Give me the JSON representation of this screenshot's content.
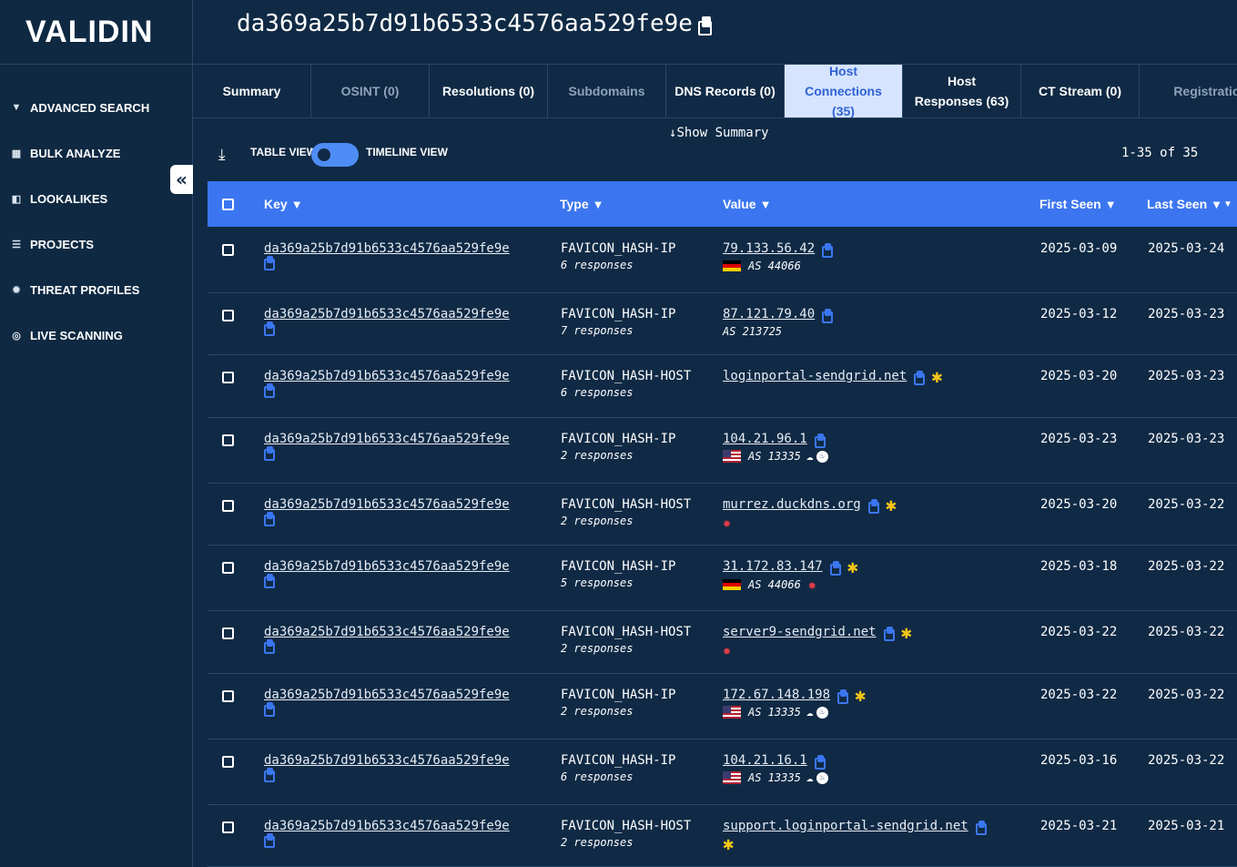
{
  "app": {
    "logo": "VALIDIN"
  },
  "sidebar": {
    "items": [
      {
        "label": "ADVANCED SEARCH",
        "icon": "filter-icon"
      },
      {
        "label": "BULK ANALYZE",
        "icon": "grid-icon"
      },
      {
        "label": "LOOKALIKES",
        "icon": "lookalike-icon"
      },
      {
        "label": "PROJECTS",
        "icon": "list-icon"
      },
      {
        "label": "THREAT PROFILES",
        "icon": "bug-icon"
      },
      {
        "label": "LIVE SCANNING",
        "icon": "target-icon"
      }
    ],
    "collapse_glyph": "«"
  },
  "header": {
    "title": "da369a25b7d91b6533c4576aa529fe9e"
  },
  "tabs": [
    {
      "label": "Summary"
    },
    {
      "label": "OSINT (0)"
    },
    {
      "label": "Resolutions (0)"
    },
    {
      "label": "Subdomains"
    },
    {
      "label": "DNS Records (0)"
    },
    {
      "label": "Host Connections (35)"
    },
    {
      "label": "Host Responses (63)"
    },
    {
      "label": "CT Stream (0)"
    },
    {
      "label": "Registration"
    }
  ],
  "toolbar": {
    "table_view": "TABLE VIEW",
    "timeline_view": "TIMELINE VIEW",
    "show_summary": "Show Summary",
    "pager": "1-35 of 35"
  },
  "table": {
    "headers": {
      "key": "Key",
      "type": "Type",
      "value": "Value",
      "first_seen": "First Seen",
      "last_seen": "Last Seen"
    },
    "rows": [
      {
        "key": "da369a25b7d91b6533c4576aa529fe9e",
        "type": "FAVICON_HASH-IP",
        "responses": "6 responses",
        "value": "79.133.56.42",
        "flag": "de",
        "as": "AS 44066",
        "star": false,
        "first": "2025-03-09",
        "last": "2025-03-24"
      },
      {
        "key": "da369a25b7d91b6533c4576aa529fe9e",
        "type": "FAVICON_HASH-IP",
        "responses": "7 responses",
        "value": "87.121.79.40",
        "flag": "",
        "as": "AS 213725",
        "star": false,
        "first": "2025-03-12",
        "last": "2025-03-23"
      },
      {
        "key": "da369a25b7d91b6533c4576aa529fe9e",
        "type": "FAVICON_HASH-HOST",
        "responses": "6 responses",
        "value": "loginportal-sendgrid.net",
        "flag": "",
        "as": "",
        "star": true,
        "first": "2025-03-20",
        "last": "2025-03-23"
      },
      {
        "key": "da369a25b7d91b6533c4576aa529fe9e",
        "type": "FAVICON_HASH-IP",
        "responses": "2 responses",
        "value": "104.21.96.1",
        "flag": "us",
        "as": "AS 13335",
        "cloud": true,
        "star": false,
        "first": "2025-03-23",
        "last": "2025-03-23"
      },
      {
        "key": "da369a25b7d91b6533c4576aa529fe9e",
        "type": "FAVICON_HASH-HOST",
        "responses": "2 responses",
        "value": "murrez.duckdns.org",
        "flag": "",
        "as": "",
        "bug": true,
        "star": true,
        "first": "2025-03-20",
        "last": "2025-03-22"
      },
      {
        "key": "da369a25b7d91b6533c4576aa529fe9e",
        "type": "FAVICON_HASH-IP",
        "responses": "5 responses",
        "value": "31.172.83.147",
        "flag": "de",
        "as": "AS 44066",
        "bug": true,
        "star": true,
        "first": "2025-03-18",
        "last": "2025-03-22"
      },
      {
        "key": "da369a25b7d91b6533c4576aa529fe9e",
        "type": "FAVICON_HASH-HOST",
        "responses": "2 responses",
        "value": "server9-sendgrid.net",
        "flag": "",
        "as": "",
        "bug": true,
        "star": true,
        "first": "2025-03-22",
        "last": "2025-03-22"
      },
      {
        "key": "da369a25b7d91b6533c4576aa529fe9e",
        "type": "FAVICON_HASH-IP",
        "responses": "2 responses",
        "value": "172.67.148.198",
        "flag": "us",
        "as": "AS 13335",
        "cloud": true,
        "star": true,
        "first": "2025-03-22",
        "last": "2025-03-22"
      },
      {
        "key": "da369a25b7d91b6533c4576aa529fe9e",
        "type": "FAVICON_HASH-IP",
        "responses": "6 responses",
        "value": "104.21.16.1",
        "flag": "us",
        "as": "AS 13335",
        "cloud": true,
        "star": false,
        "first": "2025-03-16",
        "last": "2025-03-22"
      },
      {
        "key": "da369a25b7d91b6533c4576aa529fe9e",
        "type": "FAVICON_HASH-HOST",
        "responses": "2 responses",
        "value": "support.loginportal-sendgrid.net",
        "flag": "",
        "as": "",
        "star": true,
        "star_below": true,
        "first": "2025-03-21",
        "last": "2025-03-21"
      }
    ]
  },
  "colors": {
    "background": "#102a45",
    "accent": "#3b76f0",
    "active_tab_bg": "#d6e4ff",
    "star": "#f5c518",
    "threat": "#e23a4a"
  }
}
